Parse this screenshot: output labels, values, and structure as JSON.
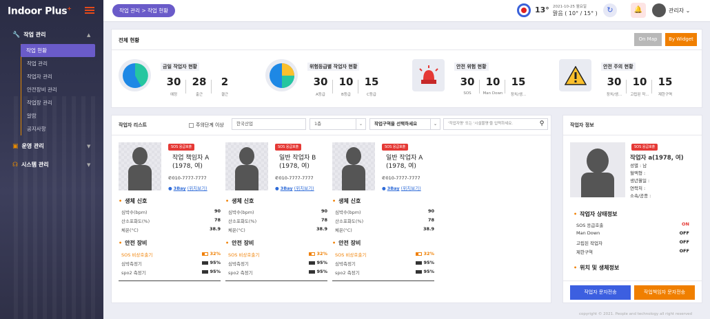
{
  "app": {
    "logo_main": "Indoor",
    "logo_plus": "Plus",
    "logo_mark": "+"
  },
  "sidebar": {
    "groups": [
      {
        "label": "작업 관리",
        "icon": "wrench-icon"
      },
      {
        "label": "운영 관리",
        "icon": "briefcase-icon"
      },
      {
        "label": "시스템 관리",
        "icon": "headset-icon"
      }
    ],
    "subitems": [
      "작업 현황",
      "작업 관리",
      "작업자 관리",
      "안전장비 관리",
      "작업장 관리",
      "알람",
      "공지사항"
    ],
    "active": "작업 현황"
  },
  "topbar": {
    "breadcrumb": "작업 관리 > 작업 현황",
    "temperature": "13°",
    "date": "2021-10-25 월요일",
    "weather": "맑음 ( 10° / 15° )",
    "user": "관리자"
  },
  "overview": {
    "title": "전체 현황",
    "btn_onmap": "On Map",
    "btn_widget": "By Widget",
    "stats": [
      {
        "title": "금일 작업자 현황",
        "values": [
          "30",
          "28",
          "2"
        ],
        "labels": [
          "예정",
          "출근",
          "결근"
        ]
      },
      {
        "title": "위험등급별 작업자 현황",
        "values": [
          "30",
          "10",
          "15"
        ],
        "labels": [
          "A등급",
          "B등급",
          "C등급"
        ]
      },
      {
        "title": "안전 위험 현황",
        "values": [
          "30",
          "10",
          "15"
        ],
        "labels": [
          "SOS",
          "Man Down",
          "장치/생..."
        ]
      },
      {
        "title": "안전 주의 현황",
        "values": [
          "30",
          "10",
          "15"
        ],
        "labels": [
          "장치/생...",
          "고립된 작...",
          "제한구역"
        ]
      }
    ]
  },
  "worker_list": {
    "title": "작업자 리스트",
    "caution_checkbox": "주의단계 이상",
    "company_field": "한국산업",
    "floor_select": "1층",
    "zone_select": "작업구역을 선택하세요",
    "search_placeholder": "'작업자명' 또는 '시설물명'을 입력하세요.",
    "cards": [
      {
        "sos": "SOS 응급호출",
        "name": "작업 책임자 A",
        "birth": "(1978, 여)",
        "phone": "010-7777-7777",
        "location": "3Bay",
        "loc_link": "(위치보기)",
        "vitals_title": "생체 신호",
        "vitals": [
          [
            "심박수(bpm)",
            "90"
          ],
          [
            "산소포화도(%)",
            "78"
          ],
          [
            "체온(°C)",
            "38.9"
          ]
        ],
        "equip_title": "안전 장비",
        "equipment": [
          [
            "SOS 비상호출기",
            "32%",
            0.32,
            true
          ],
          [
            "심박측정기",
            "95%",
            0.95,
            false
          ],
          [
            "spo2 측정기",
            "95%",
            0.95,
            false
          ]
        ]
      },
      {
        "sos": "SOS 응급호출",
        "name": "일반 작업자 B",
        "birth": "(1978, 여)",
        "phone": "010-7777-7777",
        "location": "3Bay",
        "loc_link": "(위치보기)",
        "vitals_title": "생체 신호",
        "vitals": [
          [
            "심박수(bpm)",
            "90"
          ],
          [
            "산소포화도(%)",
            "78"
          ],
          [
            "체온(°C)",
            "38.9"
          ]
        ],
        "equip_title": "안전 장비",
        "equipment": [
          [
            "SOS 비상호출기",
            "32%",
            0.32,
            true
          ],
          [
            "심박측정기",
            "95%",
            0.95,
            false
          ],
          [
            "spo2 측정기",
            "95%",
            0.95,
            false
          ]
        ]
      },
      {
        "sos": "SOS 응급호출",
        "name": "일반 작업자 A",
        "birth": "(1978, 여)",
        "phone": "010-7777-7777",
        "location": "3Bay",
        "loc_link": "(위치보기)",
        "vitals_title": "생체 신호",
        "vitals": [
          [
            "심박수(bpm)",
            "90"
          ],
          [
            "산소포화도(%)",
            "78"
          ],
          [
            "체온(°C)",
            "38.9"
          ]
        ],
        "equip_title": "안전 장비",
        "equipment": [
          [
            "SOS 비상호출기",
            "32%",
            0.32,
            true
          ],
          [
            "심박측정기",
            "95%",
            0.95,
            false
          ],
          [
            "spo2 측정기",
            "95%",
            0.95,
            false
          ]
        ]
      }
    ]
  },
  "worker_info": {
    "title": "작업자 정보",
    "sos": "SOS 응급호출",
    "name": "작업자 a(1978, 여)",
    "fields": [
      "성별 : 남",
      "혈액형 :",
      "생년월일 :",
      "연락처 :",
      "소속/공종 :"
    ],
    "status_title": "작업자 상태정보",
    "statuses": [
      [
        "SOS 응급호출",
        "ON"
      ],
      [
        "Man Down",
        "OFF"
      ],
      [
        "고립된 작업자",
        "OFF"
      ],
      [
        "제한구역",
        "OFF"
      ]
    ],
    "vitals_title": "위치 및 생체정보",
    "btn_msg_worker": "작업자 문자전송",
    "btn_msg_manager": "작업책임자 문자전송"
  },
  "footer": "copyright © 2021. People and technology all right reserved",
  "colors": {
    "accent": "#6a5bc9",
    "orange": "#f07f00",
    "danger": "#e53935",
    "blue": "#3a61d9"
  }
}
